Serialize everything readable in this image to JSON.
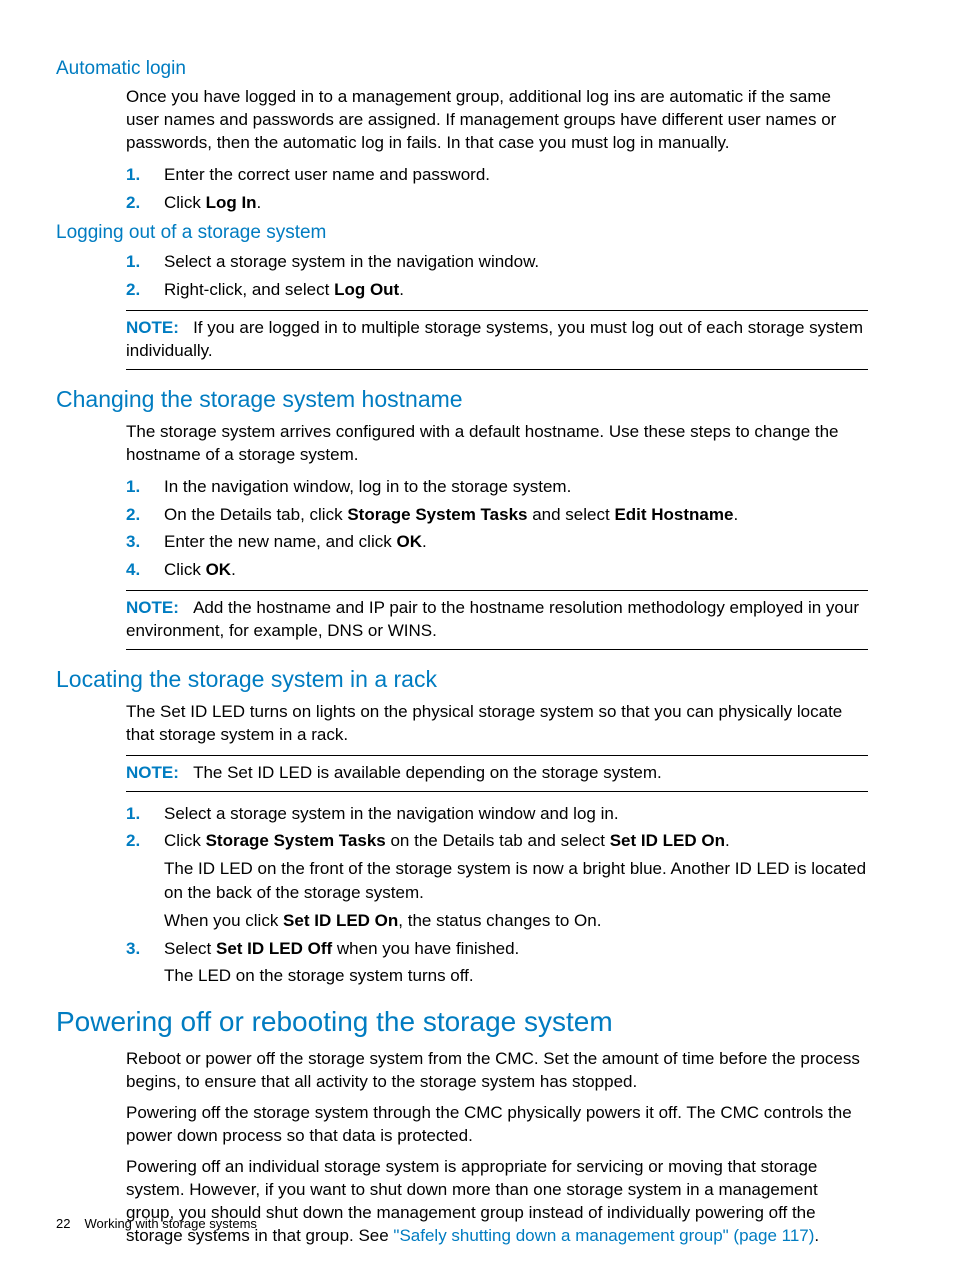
{
  "section_auto_login": {
    "heading": "Automatic login",
    "intro": "Once you have logged in to a management group, additional log ins are automatic if the same user names and passwords are assigned. If management groups have different user names or passwords, then the automatic log in fails. In that case you must log in manually.",
    "steps": [
      {
        "num": "1.",
        "text": "Enter the correct user name and password."
      },
      {
        "num": "2.",
        "pre": "Click ",
        "bold": "Log In",
        "post": "."
      }
    ]
  },
  "section_logout": {
    "heading": "Logging out of a storage system",
    "steps": [
      {
        "num": "1.",
        "text": "Select a storage system in the navigation window."
      },
      {
        "num": "2.",
        "pre": "Right-click, and select ",
        "bold": "Log Out",
        "post": "."
      }
    ],
    "note_label": "NOTE:",
    "note_text": "If you are logged in to multiple storage systems, you must log out of each storage system individually."
  },
  "section_hostname": {
    "heading": "Changing the storage system hostname",
    "intro": "The storage system arrives configured with a default hostname. Use these steps to change the hostname of a storage system.",
    "steps": [
      {
        "num": "1.",
        "text": "In the navigation window, log in to the storage system."
      },
      {
        "num": "2.",
        "pre": "On the Details tab, click ",
        "bold1": "Storage System Tasks",
        "mid": " and select ",
        "bold2": "Edit Hostname",
        "post": "."
      },
      {
        "num": "3.",
        "pre": "Enter the new name, and click ",
        "bold": "OK",
        "post": "."
      },
      {
        "num": "4.",
        "pre": "Click ",
        "bold": "OK",
        "post": "."
      }
    ],
    "note_label": "NOTE:",
    "note_text": "Add the hostname and IP pair to the hostname resolution methodology employed in your environment, for example, DNS or WINS."
  },
  "section_locate": {
    "heading": "Locating the storage system in a rack",
    "intro": "The Set ID LED turns on lights on the physical storage system so that you can physically locate that storage system in a rack.",
    "note_label": "NOTE:",
    "note_text": "The Set ID LED is available depending on the storage system.",
    "steps": {
      "s1": {
        "num": "1.",
        "text": "Select a storage system in the navigation window and log in."
      },
      "s2": {
        "num": "2.",
        "pre": "Click ",
        "bold1": "Storage System Tasks",
        "mid": " on the Details tab and select ",
        "bold2": "Set ID LED On",
        "post": "."
      },
      "s2_sub1": "The ID LED on the front of the storage system is now a bright blue. Another ID LED is located on the back of the storage system.",
      "s2_sub2_pre": "When you click ",
      "s2_sub2_bold": "Set ID LED On",
      "s2_sub2_post": ", the status changes to On.",
      "s3": {
        "num": "3.",
        "pre": "Select ",
        "bold": "Set ID LED Off",
        "post": " when you have finished."
      },
      "s3_sub": "The LED on the storage system turns off."
    }
  },
  "section_power": {
    "heading": "Powering off or rebooting the storage system",
    "p1": "Reboot or power off the storage system from the CMC. Set the amount of time before the process begins, to ensure that all activity to the storage system has stopped.",
    "p2": "Powering off the storage system through the CMC physically powers it off. The CMC controls the power down process so that data is protected.",
    "p3_pre": "Powering off an individual storage system is appropriate for servicing or moving that storage system. However, if you want to shut down more than one storage system in a management group, you should shut down the management group instead of individually powering off the storage systems in that group. See ",
    "p3_link": "\"Safely shutting down a management group\" (page 117)",
    "p3_post": "."
  },
  "footer": {
    "page": "22",
    "title": "Working with storage systems"
  }
}
